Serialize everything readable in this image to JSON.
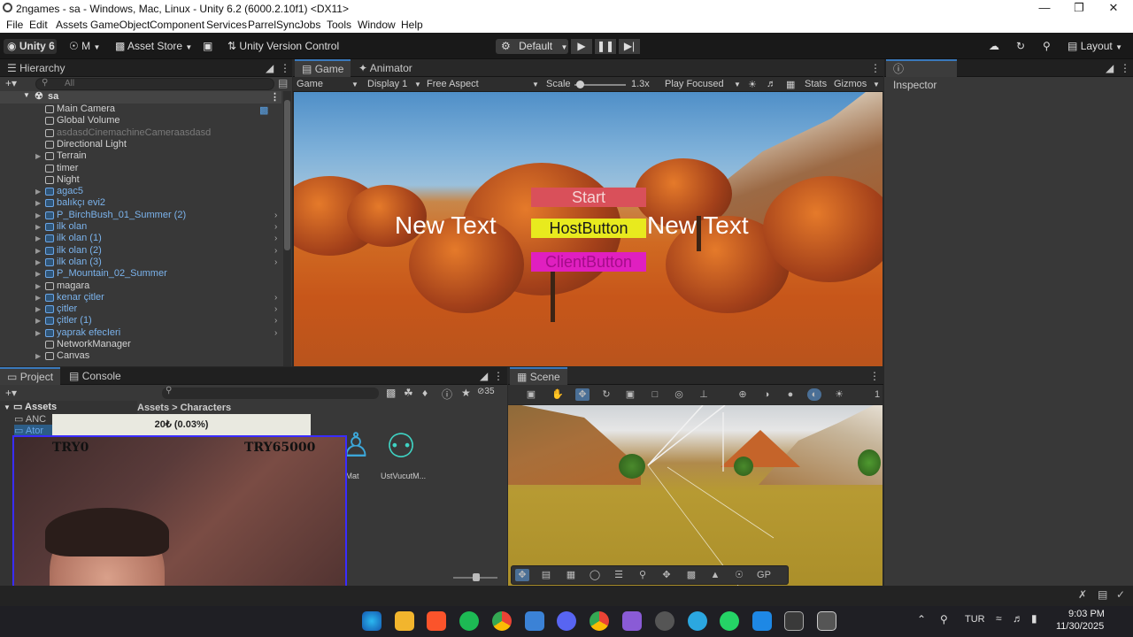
{
  "window": {
    "title": "2ngames - sa - Windows, Mac, Linux - Unity 6.2 (6000.2.10f1) <DX11>"
  },
  "menu": [
    "File",
    "Edit",
    "Assets",
    "GameObject",
    "Component",
    "Services",
    "ParrelSync",
    "Jobs",
    "Tools",
    "Window",
    "Help"
  ],
  "toolbar": {
    "account": "Unity 6",
    "user": "M",
    "asset_store": "Asset Store",
    "version_control": "Unity Version Control",
    "layout_mode": "Default",
    "layout": "Layout"
  },
  "hierarchy": {
    "tab": "Hierarchy",
    "search_placeholder": "All",
    "scene": "sa",
    "items": [
      {
        "name": "Main Camera",
        "style": "normal",
        "fold": false,
        "arrow": false
      },
      {
        "name": "Global Volume",
        "style": "normal",
        "fold": false,
        "arrow": false
      },
      {
        "name": "asdasdCinemachineCameraasdasd",
        "style": "gray",
        "fold": false,
        "arrow": false
      },
      {
        "name": "Directional Light",
        "style": "normal",
        "fold": false,
        "arrow": false
      },
      {
        "name": "Terrain",
        "style": "normal",
        "fold": true,
        "arrow": false
      },
      {
        "name": "timer",
        "style": "normal",
        "fold": false,
        "arrow": false
      },
      {
        "name": "Night",
        "style": "normal",
        "fold": false,
        "arrow": false
      },
      {
        "name": "agac5",
        "style": "blue",
        "fold": true,
        "arrow": false
      },
      {
        "name": "balıkçı evi2",
        "style": "blue",
        "fold": true,
        "arrow": false
      },
      {
        "name": "P_BirchBush_01_Summer (2)",
        "style": "blue",
        "fold": true,
        "arrow": true
      },
      {
        "name": "ilk olan",
        "style": "blue",
        "fold": true,
        "arrow": true
      },
      {
        "name": "ilk olan (1)",
        "style": "blue",
        "fold": true,
        "arrow": true
      },
      {
        "name": "ilk olan (2)",
        "style": "blue",
        "fold": true,
        "arrow": true
      },
      {
        "name": "ilk olan (3)",
        "style": "blue",
        "fold": true,
        "arrow": true
      },
      {
        "name": "P_Mountain_02_Summer",
        "style": "blue",
        "fold": true,
        "arrow": false
      },
      {
        "name": "magara",
        "style": "normal",
        "fold": true,
        "arrow": false
      },
      {
        "name": "kenar çitler",
        "style": "blue",
        "fold": true,
        "arrow": true
      },
      {
        "name": "çitler",
        "style": "blue",
        "fold": true,
        "arrow": true
      },
      {
        "name": "çitler (1)",
        "style": "blue",
        "fold": true,
        "arrow": true
      },
      {
        "name": "yaprak efecIeri",
        "style": "blue",
        "fold": true,
        "arrow": true
      },
      {
        "name": "NetworkManager",
        "style": "normal",
        "fold": false,
        "arrow": false
      },
      {
        "name": "Canvas",
        "style": "normal",
        "fold": true,
        "arrow": false
      }
    ]
  },
  "game": {
    "tab_game": "Game",
    "tab_animator": "Animator",
    "mode": "Game",
    "display": "Display 1",
    "aspect": "Free Aspect",
    "scale_label": "Scale",
    "scale_value": "1.3x",
    "scale_fraction": 0.1,
    "play_mode": "Play Focused",
    "stats": "Stats",
    "gizmos": "Gizmos",
    "ui": {
      "start": "Start",
      "host": "HostButton",
      "client": "ClientButton",
      "left_text": "New Text",
      "right_text": "New Text"
    }
  },
  "inspector": {
    "tab": "Inspector"
  },
  "project": {
    "tab_project": "Project",
    "tab_console": "Console",
    "assets_root": "Assets",
    "folders": [
      "ANC",
      "Ator"
    ],
    "breadcrumb": "Assets > Characters",
    "count": "35",
    "asset_items": [
      "ryMat",
      "UstVucutM..."
    ]
  },
  "scene": {
    "tab": "Scene",
    "gp_label": "GP",
    "side_label": "1"
  },
  "donation": {
    "bar": "20₺ (0.03%)",
    "min": "TRY0",
    "max": "TRY65000"
  },
  "taskbar": {
    "lang": "TUR",
    "time": "9:03 PM",
    "date": "11/30/2025"
  }
}
